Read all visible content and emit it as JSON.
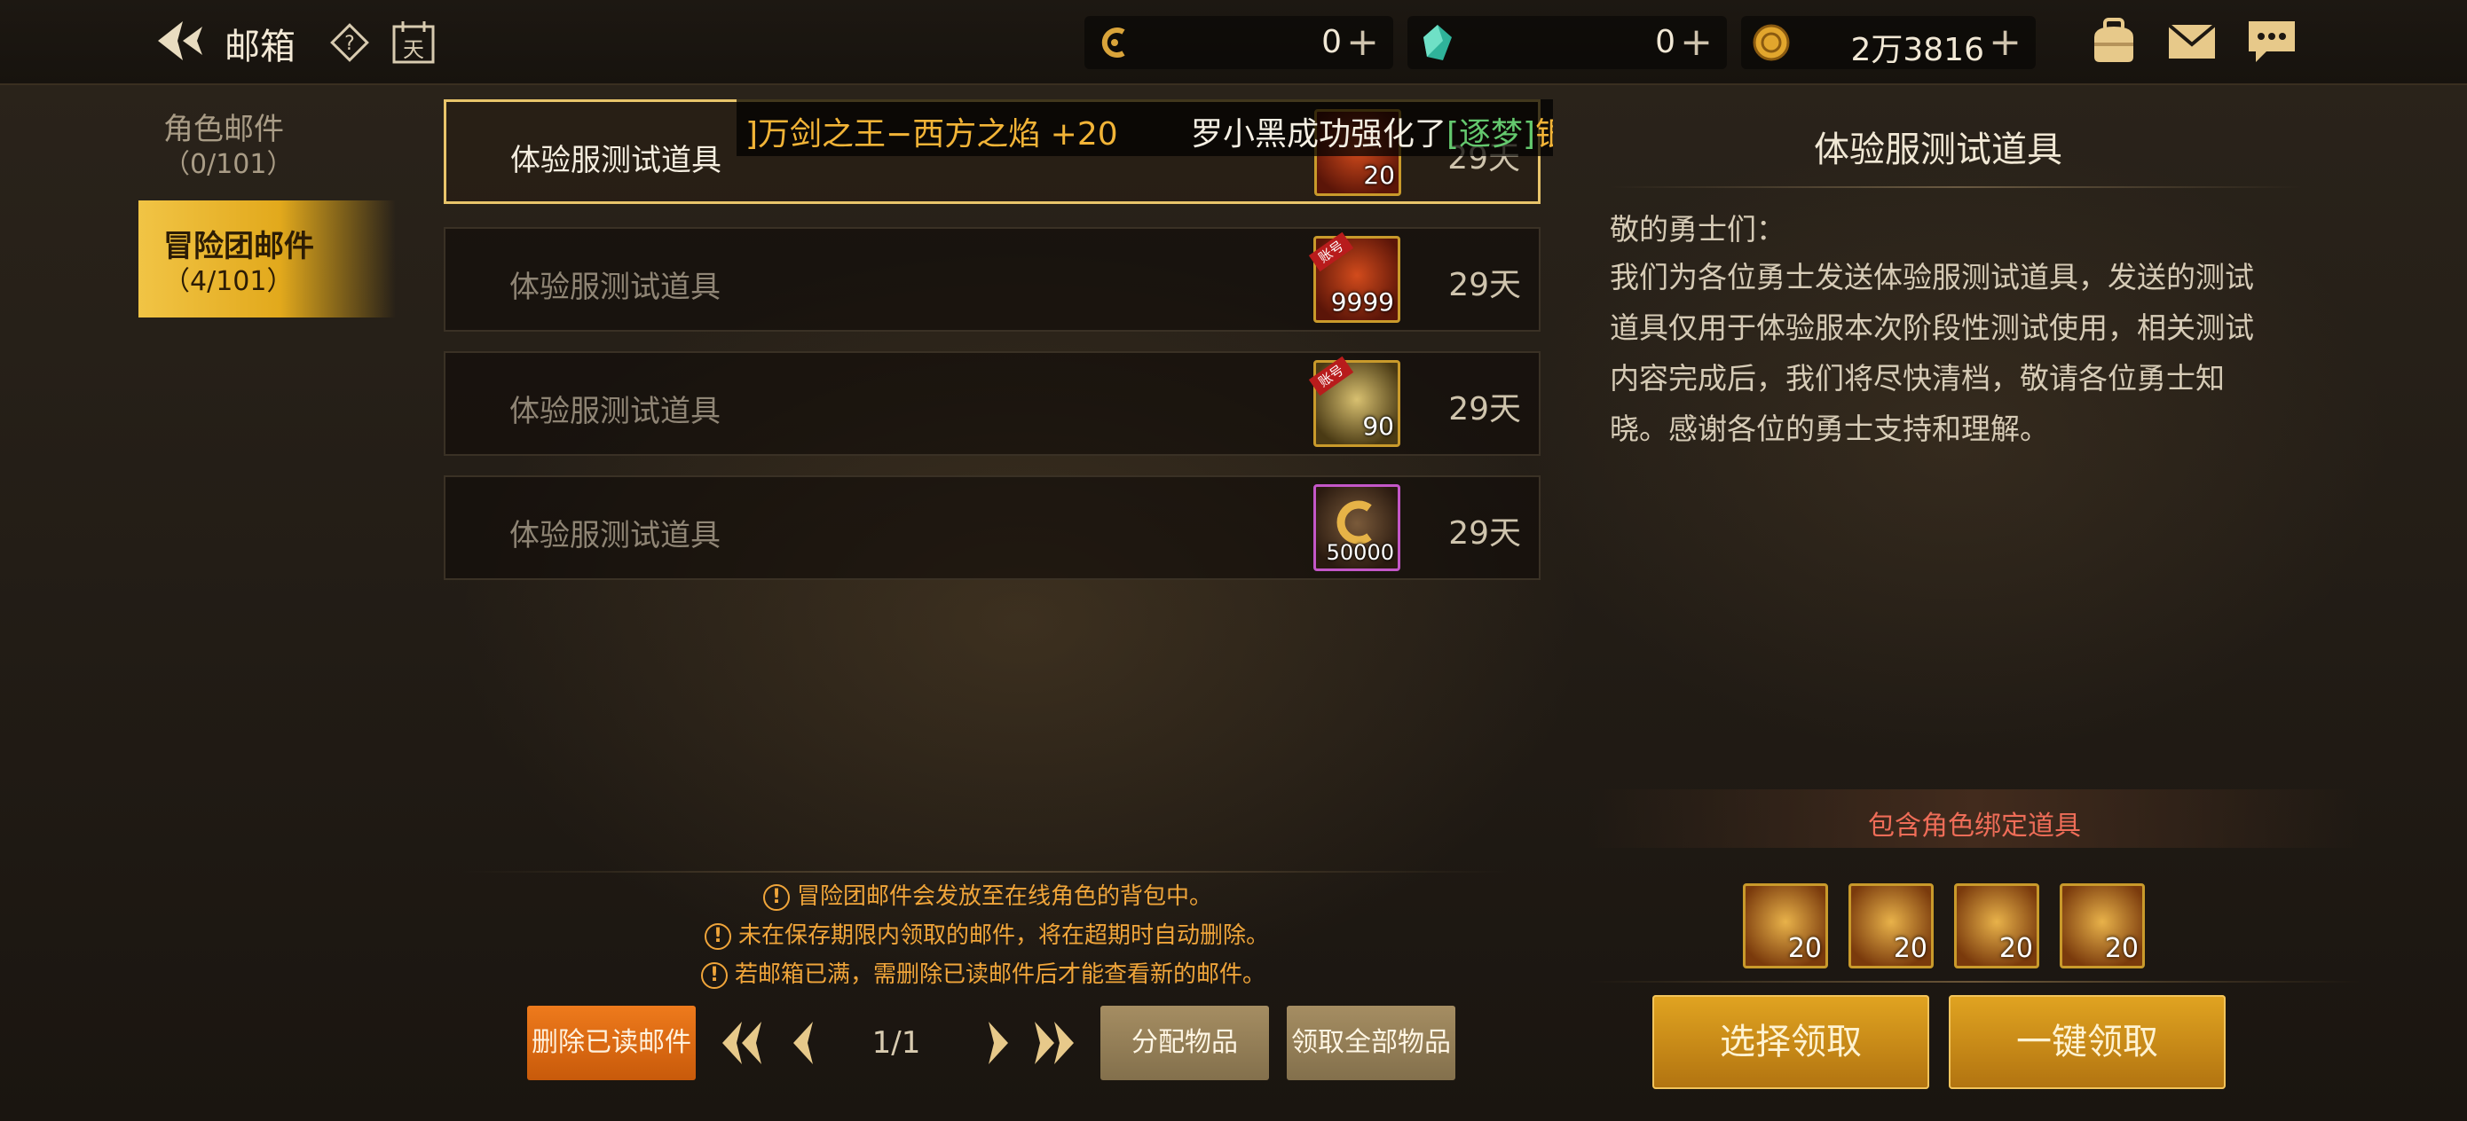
{
  "header": {
    "title": "邮箱",
    "resources": [
      {
        "name": "currency-c",
        "value": "0"
      },
      {
        "name": "crystal",
        "value": "0"
      },
      {
        "name": "gold",
        "value": "2万3816"
      }
    ],
    "plus_glyph": "+",
    "icons": [
      "back-arrow-icon",
      "help-icon",
      "calendar-icon",
      "currency-c-icon",
      "crystal-icon",
      "gold-coin-icon",
      "bag-icon",
      "mail-icon",
      "chat-icon"
    ],
    "calendar_glyph": "天",
    "help_glyph": "?"
  },
  "tabs": [
    {
      "label": "角色邮件",
      "count": "（0/101）"
    },
    {
      "label": "冒险团邮件",
      "count": "（4/101）",
      "active": true
    }
  ],
  "ticker": {
    "part1": "]万剑之王−西方之焰 +20",
    "part2": "罗小黑成功强化了",
    "part3": "[逐梦]",
    "part4": "银河占星者上"
  },
  "mails": [
    {
      "subject": "体验服测试道具",
      "days": "29天",
      "item_qty": "20",
      "selected": true
    },
    {
      "subject": "体验服测试道具",
      "days": "29天",
      "item_qty": "9999",
      "badge": "账号"
    },
    {
      "subject": "体验服测试道具",
      "days": "29天",
      "item_qty": "90",
      "badge": "账号"
    },
    {
      "subject": "体验服测试道具",
      "days": "29天",
      "item_qty": "50000"
    }
  ],
  "detail": {
    "title": "体验服测试道具",
    "greeting": "敬的勇士们：",
    "body": "我们为各位勇士发送体验服测试道具，发送的测试道具仅用于体验服本次阶段性测试使用，相关测试内容完成后，我们将尽快清档，敬请各位勇士知晓。感谢各位的勇士支持和理解。",
    "bound_notice": "包含角色绑定道具",
    "attachments": [
      {
        "qty": "20"
      },
      {
        "qty": "20"
      },
      {
        "qty": "20"
      },
      {
        "qty": "20"
      }
    ],
    "select_claim": "选择领取",
    "claim_all": "一键领取"
  },
  "notices": [
    "冒险团邮件会发放至在线角色的背包中。",
    "未在保存期限内领取的邮件，将在超期时自动删除。",
    "若邮箱已满，需删除已读邮件后才能查看新的邮件。"
  ],
  "warn_glyph": "!",
  "footer": {
    "delete_read": "删除已读邮件",
    "page": "1/1",
    "distribute": "分配物品",
    "receive_all": "领取全部物品"
  },
  "colors": {
    "accent_gold": "#e1a421",
    "active_tab": "#f1c445",
    "notice": "#f0a53a",
    "bound_text": "#ef6d58",
    "delete_button": "#ee7a1c"
  }
}
